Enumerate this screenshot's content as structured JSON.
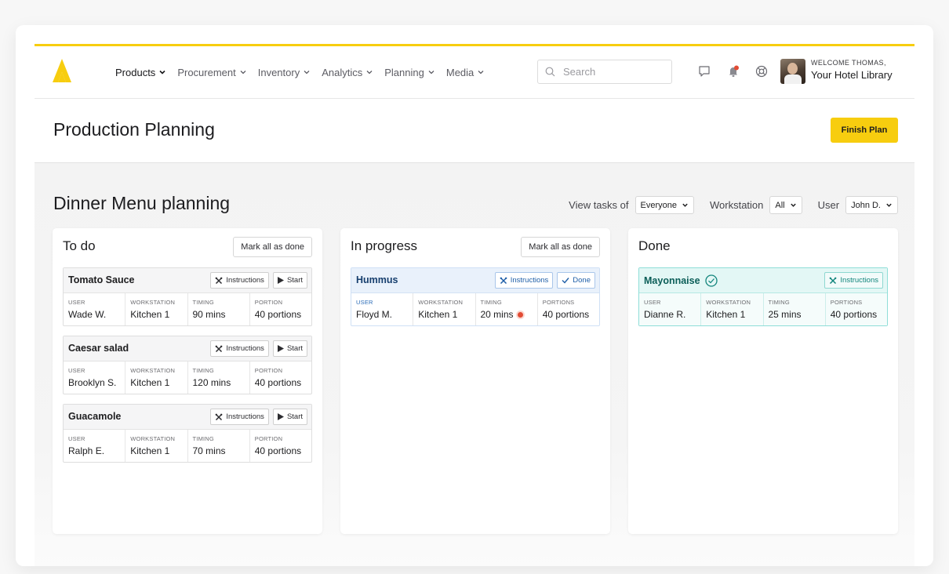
{
  "nav": {
    "menu": [
      {
        "label": "Products",
        "active": true
      },
      {
        "label": "Procurement",
        "active": false
      },
      {
        "label": "Inventory",
        "active": false
      },
      {
        "label": "Analytics",
        "active": false
      },
      {
        "label": "Planning",
        "active": false
      },
      {
        "label": "Media",
        "active": false
      }
    ],
    "search_placeholder": "Search",
    "welcome_small": "WELCOME THOMAS,",
    "welcome_big": "Your Hotel Library"
  },
  "header": {
    "title": "Production Planning",
    "finish_label": "Finish Plan"
  },
  "board": {
    "title": "Dinner Menu planning",
    "filters": {
      "view_label": "View tasks of",
      "view_value": "Everyone",
      "workstation_label": "Workstation",
      "workstation_value": "All",
      "user_label": "User",
      "user_value": "John D."
    },
    "columns": {
      "todo": {
        "title": "To do",
        "mark_label": "Mark all as done",
        "cards": [
          {
            "name": "Tomato Sauce",
            "instructions": "Instructions",
            "start": "Start",
            "labels": [
              "USER",
              "WORKSTATION",
              "TIMING",
              "PORTION"
            ],
            "values": [
              "Wade W.",
              "Kitchen 1",
              "90 mins",
              "40 portions"
            ]
          },
          {
            "name": "Caesar salad",
            "instructions": "Instructions",
            "start": "Start",
            "labels": [
              "USER",
              "WORKSTATION",
              "TIMING",
              "PORTION"
            ],
            "values": [
              "Brooklyn S.",
              "Kitchen 1",
              "120 mins",
              "40 portions"
            ]
          },
          {
            "name": "Guacamole",
            "instructions": "Instructions",
            "start": "Start",
            "labels": [
              "USER",
              "WORKSTATION",
              "TIMING",
              "PORTION"
            ],
            "values": [
              "Ralph E.",
              "Kitchen 1",
              "70 mins",
              "40 portions"
            ]
          }
        ]
      },
      "progress": {
        "title": "In progress",
        "mark_label": "Mark all as done",
        "cards": [
          {
            "name": "Hummus",
            "instructions": "Instructions",
            "done": "Done",
            "labels": [
              "USER",
              "WORKSTATION",
              "TIMING",
              "PORTIONS"
            ],
            "values": [
              "Floyd M.",
              "Kitchen 1",
              "20 mins",
              "40 portions"
            ]
          }
        ]
      },
      "done": {
        "title": "Done",
        "cards": [
          {
            "name": "Mayonnaise",
            "instructions": "Instructions",
            "labels": [
              "USER",
              "WORKSTATION",
              "TIMING",
              "PORTIONS"
            ],
            "values": [
              "Dianne R.",
              "Kitchen 1",
              "25 mins",
              "40 portions"
            ]
          }
        ]
      }
    }
  },
  "colors": {
    "accent": "#f7cd0f",
    "progress_blue": "#2b6cb8",
    "done_teal": "#11857c",
    "alert_red": "#e24b34"
  },
  "icons": [
    "logo-icon",
    "chevron-down-icon",
    "search-icon",
    "chat-icon",
    "bell-icon",
    "help-icon",
    "tools-icon",
    "play-icon",
    "check-icon",
    "check-circle-icon"
  ]
}
